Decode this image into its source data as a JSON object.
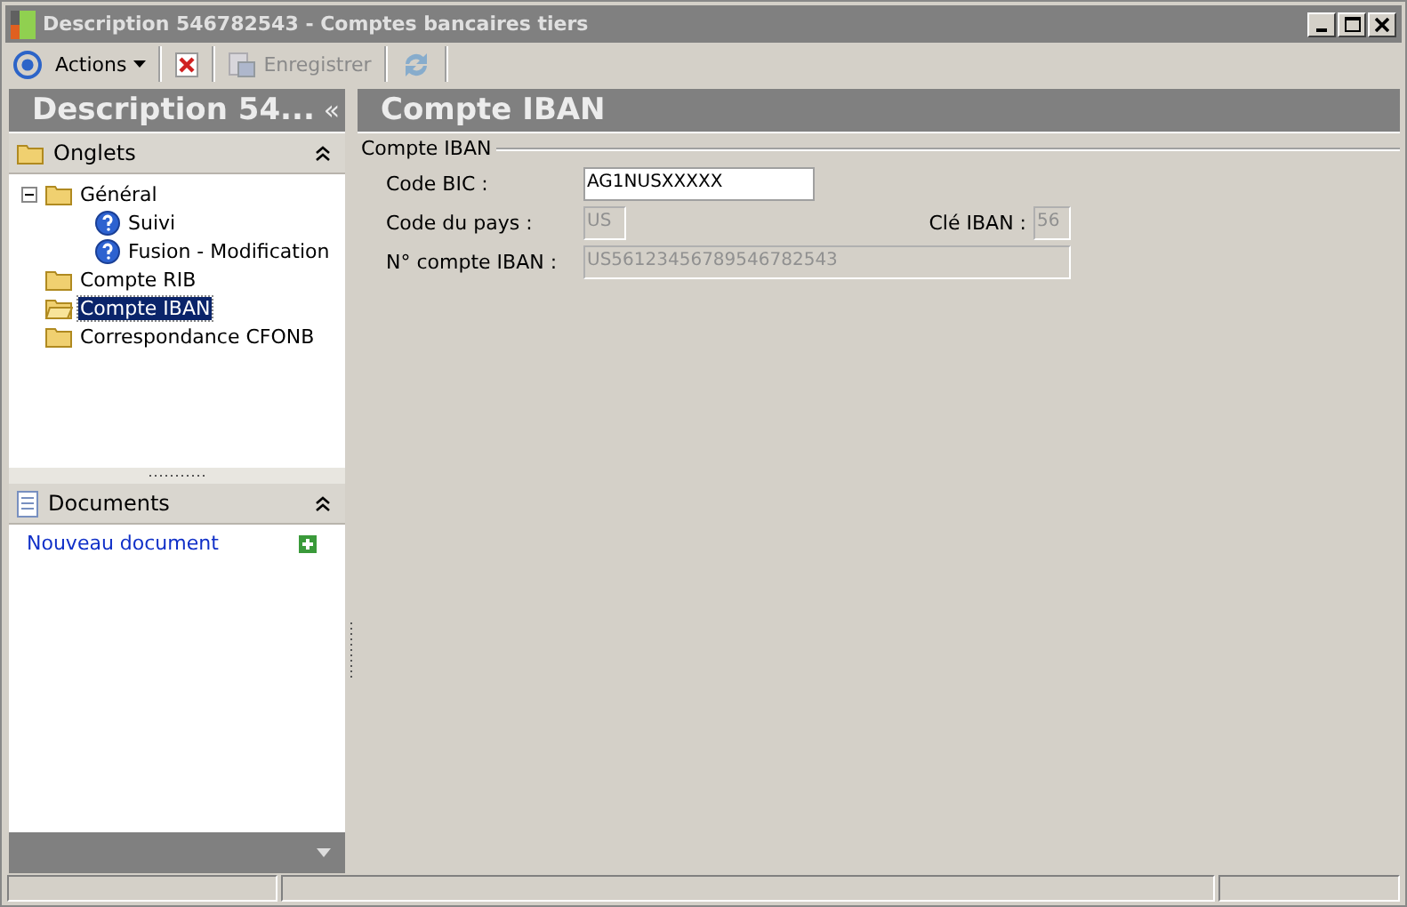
{
  "window": {
    "title": "Description 546782543 -  Comptes bancaires tiers"
  },
  "toolbar": [
    {
      "kind": "target",
      "label": "Actions",
      "disabled": false
    },
    {
      "kind": "delete",
      "disabled": false
    },
    {
      "kind": "save",
      "label": "Enregistrer",
      "disabled": true
    },
    {
      "kind": "refresh",
      "disabled": true
    }
  ],
  "sidebar": {
    "title": "Description 54...",
    "collapse": "«",
    "tabs_panel": {
      "title": "Onglets",
      "items": [
        {
          "label": "Général",
          "selected": false,
          "expanded": true,
          "children": [
            {
              "label": "Suivi",
              "selected": false
            },
            {
              "label": "Fusion - Modification",
              "selected": false
            }
          ]
        },
        {
          "label": "Compte RIB",
          "selected": false
        },
        {
          "label": "Compte IBAN",
          "selected": true
        },
        {
          "label": "Correspondance CFONB",
          "selected": false
        }
      ]
    },
    "documents_panel": {
      "title": "Documents",
      "link": "Nouveau document"
    }
  },
  "content": {
    "title": "Compte IBAN",
    "group": "Compte IBAN",
    "fields": [
      {
        "label": "Code BIC :",
        "value": "AG1NUSXXXXX",
        "disabled": false
      },
      {
        "label": "Code du pays :",
        "value": "US",
        "disabled": true
      },
      {
        "label": "Clé IBAN :",
        "value": "56",
        "disabled": true
      },
      {
        "label": "N° compte IBAN :",
        "value": "US56123456789546782543",
        "disabled": true
      }
    ]
  }
}
